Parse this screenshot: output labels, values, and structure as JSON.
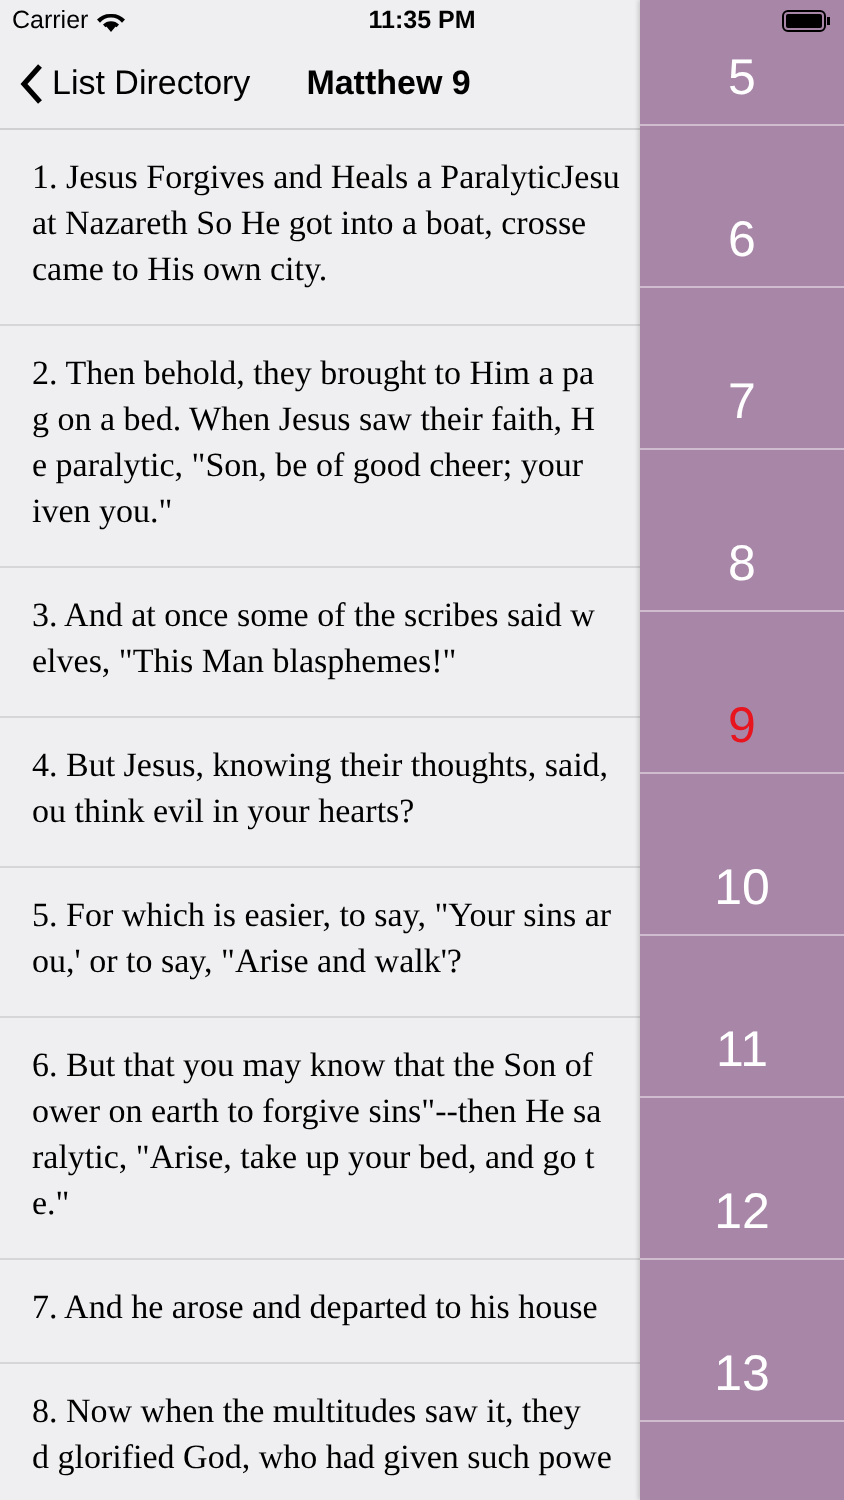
{
  "status_bar": {
    "carrier": "Carrier",
    "time": "11:35 PM"
  },
  "nav": {
    "back_label": "List Directory",
    "title": "Matthew 9"
  },
  "verses": [
    {
      "lines": [
        "1. Jesus Forgives and Heals a ParalyticJesu",
        "at Nazareth So He got into a boat, crosse",
        "came to His own city."
      ]
    },
    {
      "lines": [
        "2. Then behold, they brought to Him a pa",
        "g on a bed. When Jesus saw their faith, H",
        "e paralytic, \"Son, be of good cheer; your",
        "iven you.\""
      ]
    },
    {
      "lines": [
        "3. And at once some of the scribes said w",
        "elves, \"This Man blasphemes!\""
      ]
    },
    {
      "lines": [
        "4. But Jesus, knowing their thoughts, said,",
        "ou think evil in your hearts?"
      ]
    },
    {
      "lines": [
        "5. For which is easier, to say, \"Your sins ar",
        "ou,' or to say, \"Arise and walk'?"
      ]
    },
    {
      "lines": [
        "6. But that you may know that the Son of",
        "ower on earth to forgive sins\"--then He sa",
        "ralytic, \"Arise, take up your bed, and go t",
        "e.\""
      ]
    },
    {
      "lines": [
        "7. And he arose and departed to his house"
      ]
    },
    {
      "lines": [
        "8. Now when the multitudes saw it, they",
        "d glorified God, who had given such powe"
      ]
    }
  ],
  "index": [
    {
      "label": "5",
      "selected": false
    },
    {
      "label": "6",
      "selected": false
    },
    {
      "label": "7",
      "selected": false
    },
    {
      "label": "8",
      "selected": false
    },
    {
      "label": "9",
      "selected": true
    },
    {
      "label": "10",
      "selected": false
    },
    {
      "label": "11",
      "selected": false
    },
    {
      "label": "12",
      "selected": false
    },
    {
      "label": "13",
      "selected": false
    }
  ]
}
